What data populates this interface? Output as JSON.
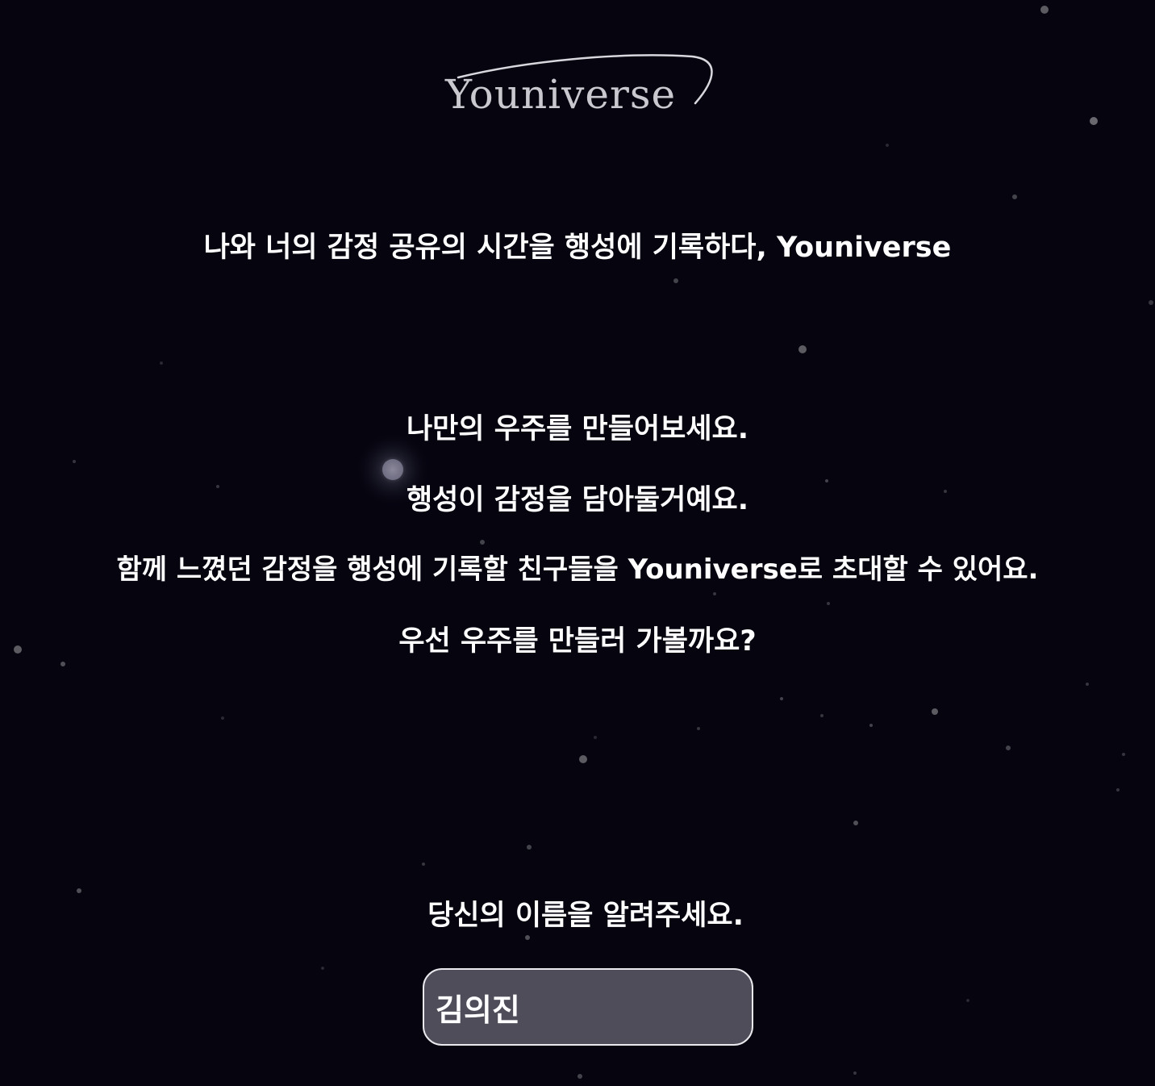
{
  "brand": {
    "logo_text": "Youniverse"
  },
  "tagline": "나와 너의 감정 공유의 시간을 행성에 기록하다, Youniverse",
  "intro": {
    "line1": "나만의 우주를 만들어보세요.",
    "line2": "행성이 감정을 담아둘거예요.",
    "line3": "함께 느꼈던 감정을 행성에 기록할 친구들을 Youniverse로 초대할 수 있어요.",
    "line4": "우선 우주를 만들러 가볼까요?"
  },
  "name_form": {
    "prompt": "당신의 이름을 알려주세요.",
    "value": "김의진"
  },
  "colors": {
    "background": "#05040f",
    "text": "#ffffff",
    "input_background": "#4f4d59",
    "input_border": "#e9e9ee"
  }
}
